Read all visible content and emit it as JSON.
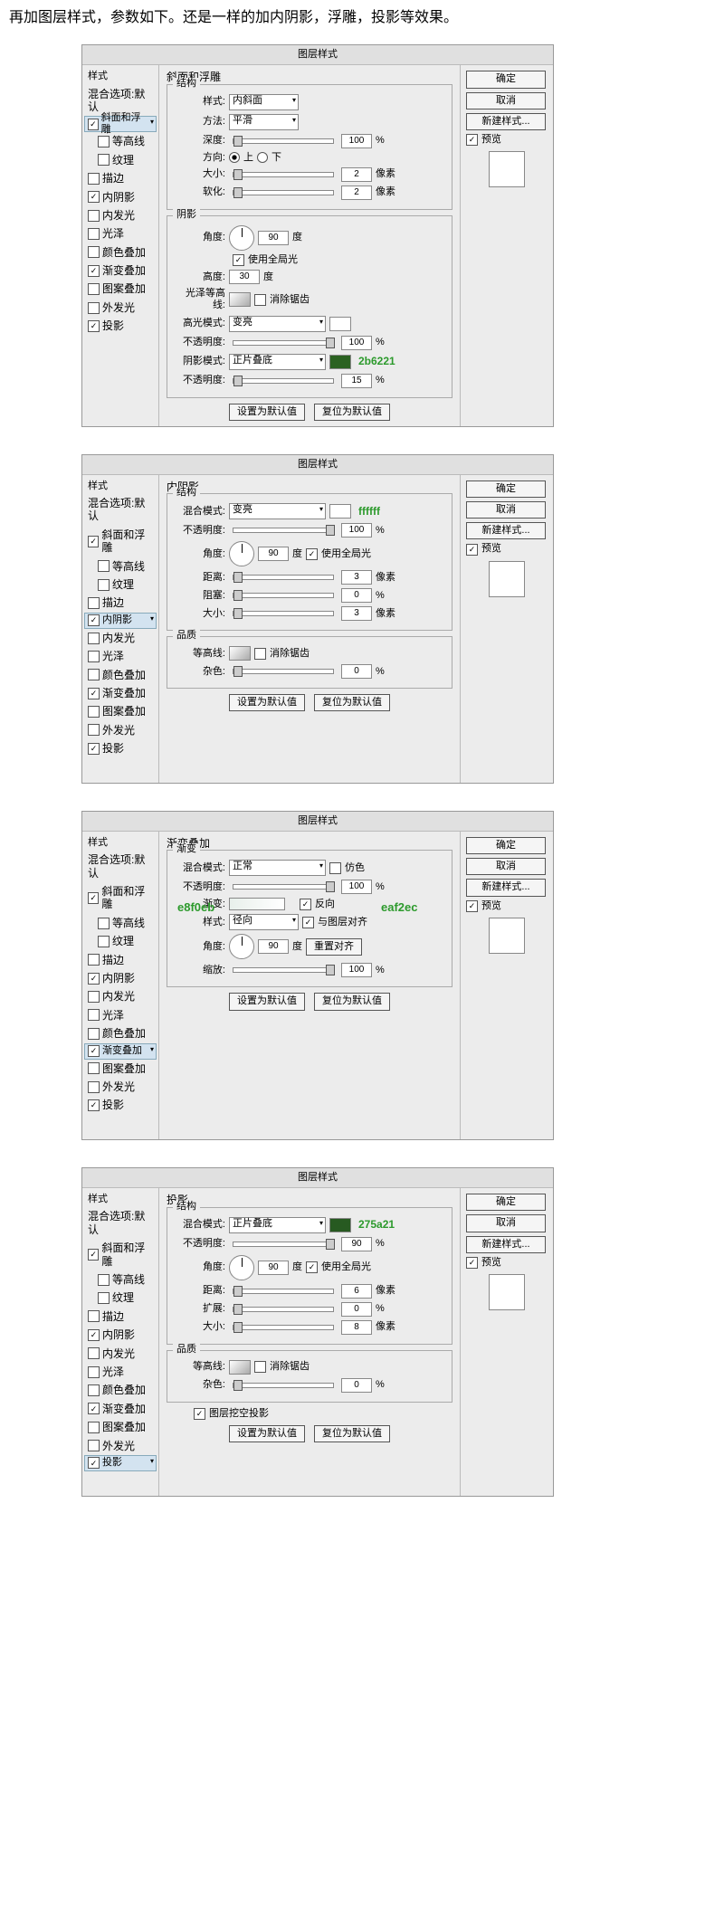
{
  "intro": "再加图层样式，参数如下。还是一样的加内阴影，浮雕，投影等效果。",
  "titles": {
    "dlg": "图层样式"
  },
  "styleList": {
    "header": "样式",
    "blend": "混合选项:默认",
    "items": [
      "斜面和浮雕",
      "等高线",
      "纹理",
      "描边",
      "内阴影",
      "内发光",
      "光泽",
      "颜色叠加",
      "渐变叠加",
      "图案叠加",
      "外发光",
      "投影"
    ]
  },
  "buttons": {
    "ok": "确定",
    "cancel": "取消",
    "new": "新建样式...",
    "make": "设置为默认值",
    "reset": "复位为默认值",
    "reset2": "重置对齐"
  },
  "preview": "预览",
  "labels": {
    "struct": "结构",
    "style": "样式:",
    "tech": "方法:",
    "depth": "深度:",
    "dir": "方向:",
    "up": "上",
    "down": "下",
    "size": "大小:",
    "soft": "软化:",
    "shading": "阴影",
    "angle": "角度:",
    "global": "使用全局光",
    "alt": "高度:",
    "gloss": "光泽等高线:",
    "anti": "消除锯齿",
    "hlmode": "高光模式:",
    "hlopac": "不透明度:",
    "shmode": "阴影模式:",
    "shopac": "不透明度:",
    "blend": "混合模式:",
    "opac": "不透明度:",
    "dist": "距离:",
    "choke": "阻塞:",
    "spread": "扩展:",
    "qual": "品质",
    "contour": "等高线:",
    "noise": "杂色:",
    "grad": "渐变叠加",
    "gradlbl": "渐变",
    "gradf": "渐变:",
    "gstyle": "样式:",
    "reverse": "反向",
    "align": "与图层对齐",
    "scale": "缩放:",
    "dither": "仿色",
    "ds": "投影",
    "knock": "图层挖空投影",
    "is": "内阴影",
    "be": "斜面和浮雕",
    "px": "像素",
    "deg": "度",
    "pct": "%"
  },
  "panel1": {
    "style": "内斜面",
    "tech": "平滑",
    "depth": "100",
    "size": "2",
    "soft": "2",
    "angle": "90",
    "alt": "30",
    "hlmode": "变亮",
    "hlopac": "100",
    "shmode": "正片叠底",
    "shopac": "15",
    "color": "2b6221"
  },
  "panel2": {
    "mode": "变亮",
    "color": "ffffff",
    "opac": "100",
    "angle": "90",
    "dist": "3",
    "choke": "0",
    "size": "3",
    "noise": "0"
  },
  "panel3": {
    "mode": "正常",
    "opac": "100",
    "style": "径向",
    "angle": "90",
    "scale": "100",
    "c1": "e8f0eb",
    "c2": "eaf2ec"
  },
  "panel4": {
    "mode": "正片叠底",
    "color": "275a21",
    "opac": "90",
    "angle": "90",
    "dist": "6",
    "spread": "0",
    "size": "8",
    "noise": "0"
  },
  "checked": {
    "p1": [
      true,
      false,
      false,
      false,
      true,
      false,
      false,
      false,
      true,
      false,
      false,
      true
    ],
    "p2": [
      true,
      false,
      false,
      false,
      true,
      false,
      false,
      false,
      true,
      false,
      false,
      true
    ],
    "p3": [
      true,
      false,
      false,
      false,
      true,
      false,
      false,
      false,
      true,
      false,
      false,
      true
    ],
    "p4": [
      true,
      false,
      false,
      false,
      true,
      false,
      false,
      false,
      true,
      false,
      false,
      true
    ]
  }
}
